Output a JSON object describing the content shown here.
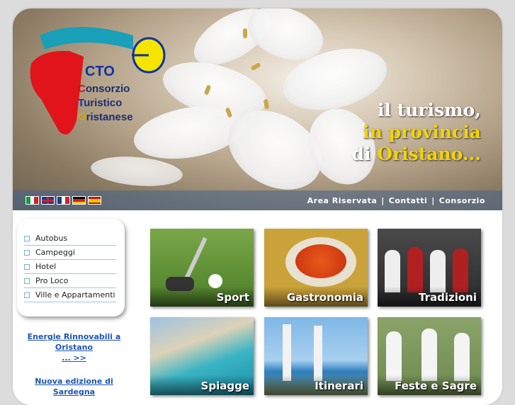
{
  "logo": {
    "cto": "CTO",
    "line1": {
      "first": "C",
      "rest": "onsorzio"
    },
    "line2": {
      "first": "T",
      "rest": "uristico"
    },
    "line3": {
      "first": "O",
      "rest": "ristanese"
    }
  },
  "tagline": {
    "line1": "il turismo,",
    "line2": "in provincia",
    "line3a": "di ",
    "line3b": "Oristano..."
  },
  "top_links": [
    "Area Riservata",
    "Contatti",
    "Consorzio"
  ],
  "top_link_separator": "|",
  "languages": [
    "italian-flag-icon",
    "uk-flag-icon",
    "french-flag-icon",
    "german-flag-icon",
    "spanish-flag-icon"
  ],
  "menu": {
    "items": [
      {
        "label": "Autobus"
      },
      {
        "label": "Campeggi"
      },
      {
        "label": "Hotel"
      },
      {
        "label": "Pro Loco"
      },
      {
        "label": "Ville e Appartamenti"
      }
    ]
  },
  "news": {
    "link1": "Energie Rinnovabili a Oristano",
    "more": "... >>",
    "link2": "Nuova edizione di Sardegna"
  },
  "tiles": [
    {
      "label": "Sport"
    },
    {
      "label": "Gastronomia"
    },
    {
      "label": "Tradizioni"
    },
    {
      "label": "Spiagge"
    },
    {
      "label": "Itinerari"
    },
    {
      "label": "Feste e Sagre"
    }
  ],
  "colors": {
    "brand_blue": "#1033a0",
    "brand_red": "#c0141a",
    "brand_yellow": "#f5e400",
    "brand_cyan": "#1a9fb8",
    "link": "#1e56b0"
  }
}
